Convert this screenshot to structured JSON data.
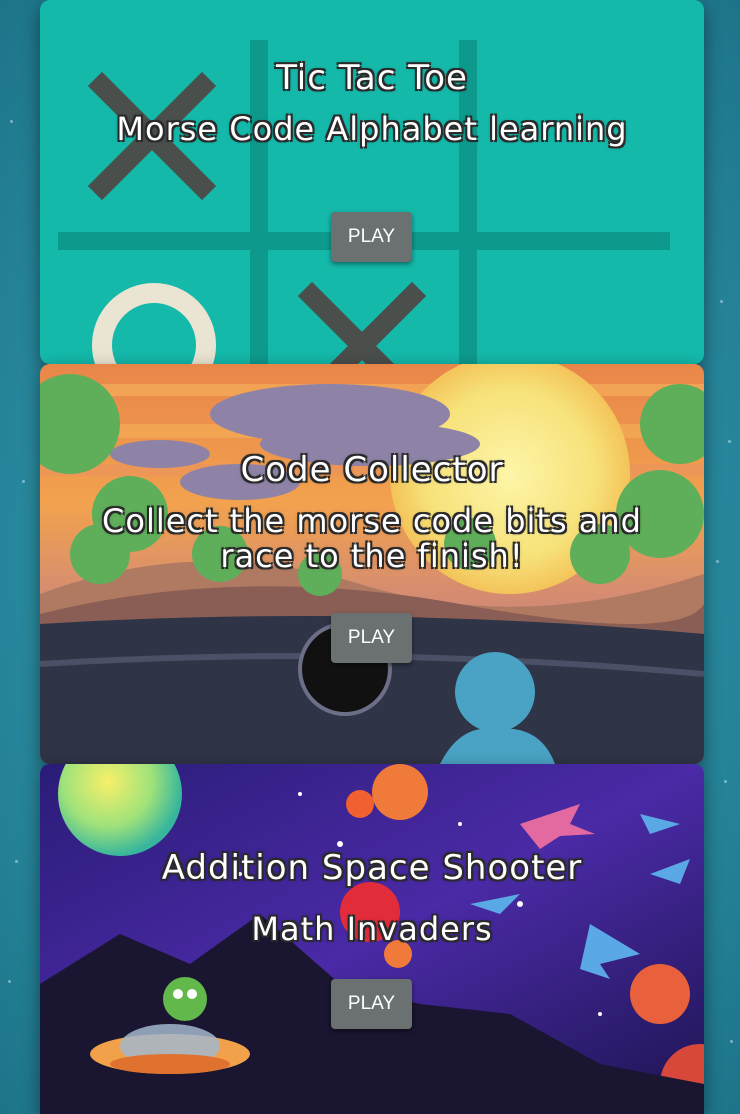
{
  "cards": [
    {
      "title": "Tic Tac Toe",
      "subtitle": "Morse Code Alphabet learning",
      "button": "PLAY",
      "accent": "#14b9aa"
    },
    {
      "title": "Code Collector",
      "subtitle": "Collect the morse code bits and race to the finish!",
      "button": "PLAY",
      "accent": "#f0a040"
    },
    {
      "title": "Addition Space Shooter",
      "subtitle": "Math Invaders",
      "button": "PLAY",
      "accent": "#3a2a8c"
    }
  ]
}
